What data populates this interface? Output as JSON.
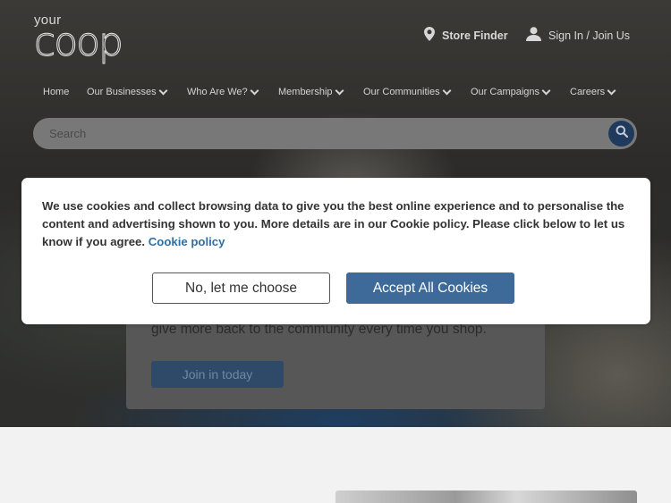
{
  "logo": {
    "small": "your",
    "main": "coop"
  },
  "header": {
    "store_finder": "Store Finder",
    "sign_in": "Sign In / Join Us"
  },
  "nav": {
    "items": [
      {
        "label": "Home",
        "has_dropdown": false
      },
      {
        "label": "Our Businesses",
        "has_dropdown": true
      },
      {
        "label": "Who Are We?",
        "has_dropdown": true
      },
      {
        "label": "Membership",
        "has_dropdown": true
      },
      {
        "label": "Our Communities",
        "has_dropdown": true
      },
      {
        "label": "Our Campaigns",
        "has_dropdown": true
      },
      {
        "label": "Careers",
        "has_dropdown": true
      }
    ]
  },
  "search": {
    "placeholder": "Search"
  },
  "hero": {
    "text": "give more back to the community every time you shop.",
    "join_button": "Join in today"
  },
  "cookie": {
    "message": "We use cookies and collect browsing data to give you the best online experience and to personalise the content and advertising shown to you. More details are in our Cookie policy. Please click below to let us know if you agree.",
    "link": "Cookie policy",
    "choose_button": "No, let me choose",
    "accept_button": "Accept All Cookies"
  },
  "colors": {
    "accent": "#3d6a98",
    "search_button": "#1f3a5c",
    "link": "#2d6ea6"
  },
  "icons": [
    "location-pin-icon",
    "user-icon",
    "chevron-down-icon",
    "search-icon"
  ]
}
